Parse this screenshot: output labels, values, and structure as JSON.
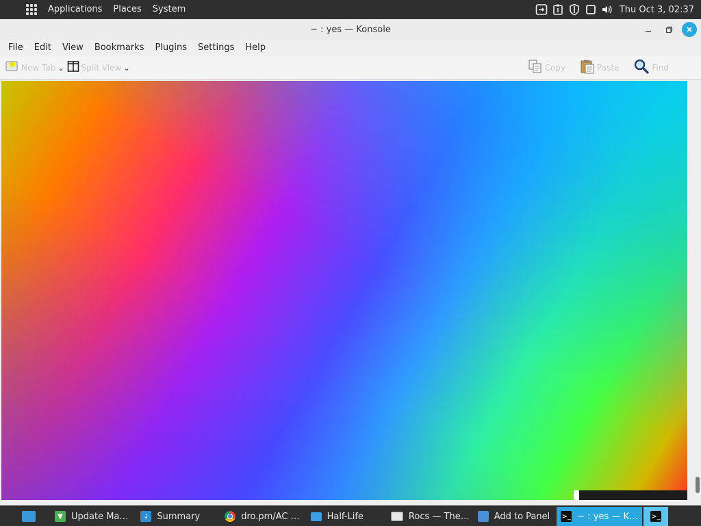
{
  "top_panel": {
    "menus": [
      "Applications",
      "Places",
      "System"
    ],
    "tray_icons": [
      "screen-rotate-icon",
      "clipboard-icon",
      "shield-icon",
      "window-icon",
      "volume-icon"
    ],
    "clock": "Thu Oct  3, 02:37"
  },
  "window": {
    "title": "~ : yes — Konsole",
    "controls": [
      "minimize-icon",
      "maximize-icon",
      "close-icon"
    ],
    "menubar": [
      "File",
      "Edit",
      "View",
      "Bookmarks",
      "Plugins",
      "Settings",
      "Help"
    ],
    "toolbar": {
      "left": [
        {
          "label": "New Tab",
          "icon": "new-tab-icon"
        },
        {
          "label": "Split View",
          "icon": "split-view-icon"
        }
      ],
      "right": [
        {
          "label": "Copy",
          "icon": "copy-icon"
        },
        {
          "label": "Paste",
          "icon": "paste-icon"
        },
        {
          "label": "Find",
          "icon": "search-icon"
        }
      ]
    }
  },
  "taskbar": {
    "items": [
      {
        "label": "",
        "icon": "show-desktop-icon",
        "color": "#3a9ad9"
      },
      {
        "label": "Update Ma…",
        "icon": "update-manager-icon",
        "color": "#4caf50"
      },
      {
        "label": "Summary",
        "icon": "download-icon",
        "color": "#2e8bd6"
      },
      {
        "label": "dro.pm/AC …",
        "icon": "chrome-icon",
        "color": "#e0b000"
      },
      {
        "label": "Half-Life",
        "icon": "folder-icon",
        "color": "#3aa0e8"
      },
      {
        "label": "Rocs — The…",
        "icon": "rocs-icon",
        "color": "#888888"
      },
      {
        "label": "Add to Panel",
        "icon": "add-panel-icon",
        "color": "#4a90d9"
      },
      {
        "label": "~ : yes — K…",
        "icon": "terminal-icon",
        "color": "#111111"
      },
      {
        "label": "",
        "icon": "terminal-icon",
        "color": "#111111"
      }
    ]
  }
}
